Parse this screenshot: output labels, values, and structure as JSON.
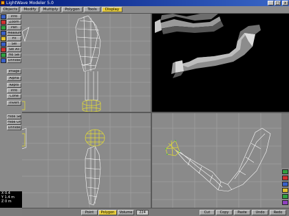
{
  "window": {
    "title": "LightWave Modeler 5.0",
    "min_label": "_",
    "max_label": "□",
    "close_label": "x"
  },
  "tabs": [
    "Objects",
    "Modify",
    "Multiply",
    "Polygon",
    "Tools",
    "Display"
  ],
  "active_tab": "Display",
  "left_buttons": [
    "Info",
    "Zoom",
    "Pan",
    "Measure",
    "Fit",
    "Sel",
    "Sel All",
    "Hd Sel",
    "Unhide",
    "Image",
    "Alpha",
    "Kepts",
    "Info",
    "Cone",
    "Invert",
    "Hide Sel",
    "Hide Unsel",
    "Unhide"
  ],
  "coords": {
    "x": "X 0.4",
    "y": "Y 1.4 m",
    "z": "Z 0 m"
  },
  "bottom": {
    "point_label": "Point",
    "polygon_label": "Polygon",
    "volume_label": "Volume",
    "value": "224",
    "cut_label": "Cut",
    "copy_label": "Copy",
    "paste_label": "Paste",
    "undo_label": "Undo",
    "redo_label": "Redo"
  },
  "colors": {
    "wire": "#ffffff",
    "selected": "#e8e030",
    "grid": "#a8a8a8",
    "perspective_bg": "#000000",
    "viewport_bg": "#8a8a8a"
  }
}
